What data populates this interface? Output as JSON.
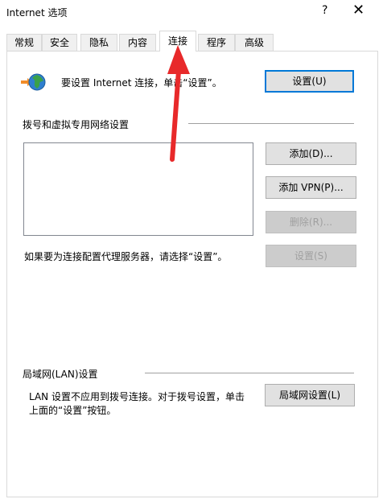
{
  "window": {
    "title": "Internet 选项",
    "help_icon": "?",
    "close_icon": "✕"
  },
  "tabs": [
    {
      "label": "常规"
    },
    {
      "label": "安全"
    },
    {
      "label": "隐私"
    },
    {
      "label": "内容"
    },
    {
      "label": "连接",
      "active": true
    },
    {
      "label": "程序"
    },
    {
      "label": "高级"
    }
  ],
  "setup": {
    "text": "要设置 Internet 连接，单击“设置”。",
    "button": "设置(U)"
  },
  "dialup": {
    "group_label": "拨号和虚拟专用网络设置",
    "add_button": "添加(D)...",
    "add_vpn_button": "添加 VPN(P)...",
    "remove_button": "删除(R)...",
    "proxy_text": "如果要为连接配置代理服务器，请选择“设置”。",
    "settings_button": "设置(S)"
  },
  "lan": {
    "group_label": "局域网(LAN)设置",
    "text_line1": "LAN 设置不应用到拨号连接。对于拨号设置，单击",
    "text_line2": "上面的“设置”按钮。",
    "button": "局域网设置(L)"
  },
  "colors": {
    "annotation_arrow": "#e8292a",
    "accent_border": "#0078d7"
  }
}
